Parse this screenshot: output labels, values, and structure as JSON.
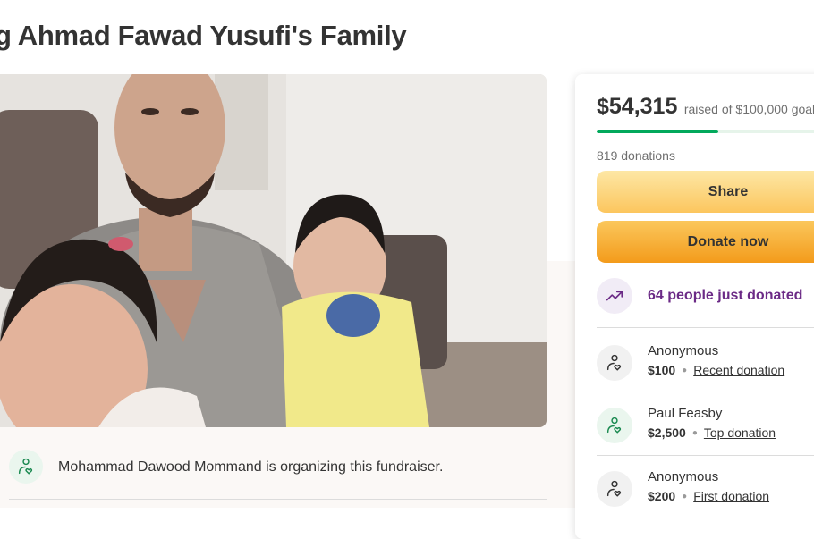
{
  "page": {
    "title": "g Ahmad Fawad Yusufi's Family"
  },
  "organizer": {
    "text": "Mohammad Dawood Mommand is organizing this fundraiser.",
    "icon": "heart-hand-icon"
  },
  "summary": {
    "amount_raised": "$54,315",
    "goal_text": "raised of $100,000 goal",
    "progress_fraction": 0.54315,
    "donation_count": "819 donations",
    "share_label": "Share",
    "donate_label": "Donate now",
    "trend_text": "64 people just donated",
    "trend_icon": "trending-up-icon"
  },
  "donations": [
    {
      "name": "Anonymous",
      "amount": "$100",
      "tag": "Recent donation",
      "icon": "heart-hand-icon"
    },
    {
      "name": "Paul Feasby",
      "amount": "$2,500",
      "tag": "Top donation",
      "icon": "heart-hand-icon"
    },
    {
      "name": "Anonymous",
      "amount": "$200",
      "tag": "First donation",
      "icon": "heart-hand-icon"
    }
  ],
  "colors": {
    "progress": "#02a95c",
    "share_button": "#fcd27a",
    "donate_button": "#f6a628",
    "trend_text": "#6b2a86"
  }
}
